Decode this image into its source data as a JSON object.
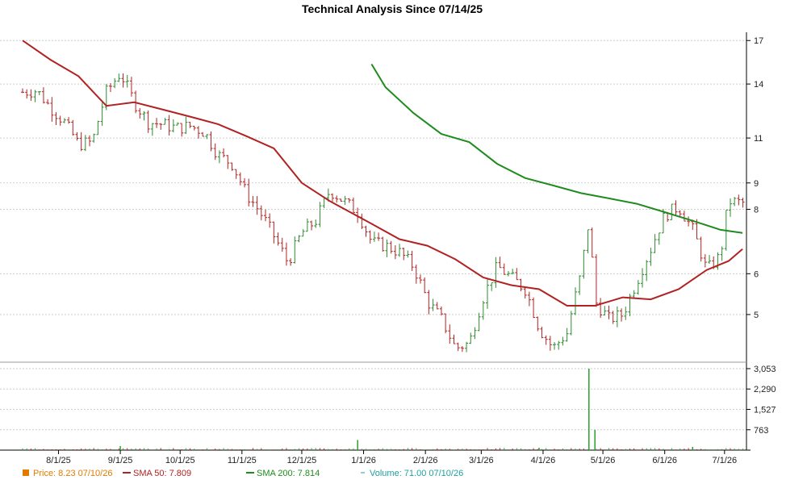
{
  "chart_data": {
    "type": "line",
    "title": "Technical Analysis Since 07/14/25",
    "price_axis": {
      "ticks": [
        "17",
        "14",
        "11",
        "9",
        "8",
        "6",
        "5"
      ],
      "tick_values": [
        17,
        14,
        11,
        9,
        8,
        6,
        5
      ],
      "scale": "log",
      "range": [
        4.1,
        17.2
      ]
    },
    "volume_axis": {
      "ticks": [
        "3,053",
        "2,290",
        "1,527",
        "763"
      ],
      "tick_values": [
        3053,
        2290,
        1527,
        763
      ],
      "range": [
        0,
        3053
      ]
    },
    "x_axis": {
      "ticks": [
        "8/1/25",
        "9/1/25",
        "10/1/25",
        "11/1/25",
        "12/1/25",
        "1/1/26",
        "2/1/26",
        "3/1/26",
        "4/1/26",
        "5/1/26",
        "6/1/26",
        "7/1/26"
      ],
      "tick_dates": [
        "2025-08-01",
        "2025-09-01",
        "2025-10-01",
        "2025-11-01",
        "2025-12-01",
        "2026-01-01",
        "2026-02-01",
        "2026-03-01",
        "2026-04-01",
        "2026-05-01",
        "2026-06-01",
        "2026-07-01"
      ]
    },
    "grid": true,
    "colors": {
      "up": "#2e8b2e",
      "down": "#b22222",
      "sma50": "#b22222",
      "sma200": "#1e8c1e",
      "volume": "#2aa02a",
      "price_legend": "#e07b00",
      "volume_legend": "#20a0a0"
    },
    "price_closes": [
      {
        "date": "2025-07-14",
        "close": 13.5
      },
      {
        "date": "2025-07-21",
        "close": 13.6
      },
      {
        "date": "2025-07-28",
        "close": 12.6
      },
      {
        "date": "2025-08-04",
        "close": 11.8
      },
      {
        "date": "2025-08-11",
        "close": 10.7
      },
      {
        "date": "2025-08-18",
        "close": 10.8
      },
      {
        "date": "2025-08-25",
        "close": 13.5
      },
      {
        "date": "2025-09-01",
        "close": 14.7
      },
      {
        "date": "2025-09-08",
        "close": 12.9
      },
      {
        "date": "2025-09-15",
        "close": 11.8
      },
      {
        "date": "2025-09-22",
        "close": 11.7
      },
      {
        "date": "2025-09-29",
        "close": 11.5
      },
      {
        "date": "2025-10-06",
        "close": 11.6
      },
      {
        "date": "2025-10-13",
        "close": 11.3
      },
      {
        "date": "2025-10-20",
        "close": 10.2
      },
      {
        "date": "2025-10-27",
        "close": 9.8
      },
      {
        "date": "2025-11-03",
        "close": 8.6
      },
      {
        "date": "2025-11-10",
        "close": 7.9
      },
      {
        "date": "2025-11-17",
        "close": 7.1
      },
      {
        "date": "2025-11-24",
        "close": 6.3
      },
      {
        "date": "2025-12-01",
        "close": 7.2
      },
      {
        "date": "2025-12-08",
        "close": 7.6
      },
      {
        "date": "2025-12-15",
        "close": 8.7
      },
      {
        "date": "2025-12-22",
        "close": 8.3
      },
      {
        "date": "2025-12-29",
        "close": 7.9
      },
      {
        "date": "2026-01-05",
        "close": 6.9
      },
      {
        "date": "2026-01-12",
        "close": 6.8
      },
      {
        "date": "2026-01-19",
        "close": 6.6
      },
      {
        "date": "2026-01-26",
        "close": 6.2
      },
      {
        "date": "2026-02-02",
        "close": 5.3
      },
      {
        "date": "2026-02-09",
        "close": 4.9
      },
      {
        "date": "2026-02-16",
        "close": 4.3
      },
      {
        "date": "2026-02-23",
        "close": 4.4
      },
      {
        "date": "2026-03-02",
        "close": 5.4
      },
      {
        "date": "2026-03-09",
        "close": 6.2
      },
      {
        "date": "2026-03-16",
        "close": 5.9
      },
      {
        "date": "2026-03-23",
        "close": 5.6
      },
      {
        "date": "2026-03-30",
        "close": 4.7
      },
      {
        "date": "2026-04-06",
        "close": 4.3
      },
      {
        "date": "2026-04-13",
        "close": 4.6
      },
      {
        "date": "2026-04-20",
        "close": 6.0
      },
      {
        "date": "2026-04-24",
        "close": 7.6
      },
      {
        "date": "2026-04-27",
        "close": 5.3
      },
      {
        "date": "2026-05-04",
        "close": 4.9
      },
      {
        "date": "2026-05-11",
        "close": 5.0
      },
      {
        "date": "2026-05-18",
        "close": 5.8
      },
      {
        "date": "2026-05-25",
        "close": 6.7
      },
      {
        "date": "2026-06-01",
        "close": 7.8
      },
      {
        "date": "2026-06-08",
        "close": 8.1
      },
      {
        "date": "2026-06-15",
        "close": 7.3
      },
      {
        "date": "2026-06-22",
        "close": 6.1
      },
      {
        "date": "2026-06-29",
        "close": 6.5
      },
      {
        "date": "2026-07-03",
        "close": 8.3
      },
      {
        "date": "2026-07-10",
        "close": 8.23
      }
    ],
    "sma50_points": [
      {
        "date": "2025-07-14",
        "value": 17.0
      },
      {
        "date": "2025-07-28",
        "value": 15.6
      },
      {
        "date": "2025-08-11",
        "value": 14.5
      },
      {
        "date": "2025-08-25",
        "value": 12.7
      },
      {
        "date": "2025-09-08",
        "value": 12.9
      },
      {
        "date": "2025-09-22",
        "value": 12.5
      },
      {
        "date": "2025-10-06",
        "value": 12.1
      },
      {
        "date": "2025-10-20",
        "value": 11.7
      },
      {
        "date": "2025-11-03",
        "value": 11.1
      },
      {
        "date": "2025-11-17",
        "value": 10.5
      },
      {
        "date": "2025-12-01",
        "value": 9.0
      },
      {
        "date": "2025-12-15",
        "value": 8.3
      },
      {
        "date": "2026-01-05",
        "value": 7.5
      },
      {
        "date": "2026-01-19",
        "value": 7.0
      },
      {
        "date": "2026-02-02",
        "value": 6.8
      },
      {
        "date": "2026-02-16",
        "value": 6.4
      },
      {
        "date": "2026-03-02",
        "value": 5.9
      },
      {
        "date": "2026-03-16",
        "value": 5.7
      },
      {
        "date": "2026-03-30",
        "value": 5.6
      },
      {
        "date": "2026-04-13",
        "value": 5.2
      },
      {
        "date": "2026-04-27",
        "value": 5.2
      },
      {
        "date": "2026-05-11",
        "value": 5.4
      },
      {
        "date": "2026-05-25",
        "value": 5.35
      },
      {
        "date": "2026-06-08",
        "value": 5.6
      },
      {
        "date": "2026-06-22",
        "value": 6.1
      },
      {
        "date": "2026-07-03",
        "value": 6.35
      },
      {
        "date": "2026-07-10",
        "value": 6.7
      }
    ],
    "sma200_points": [
      {
        "date": "2026-01-05",
        "value": 15.3
      },
      {
        "date": "2026-01-12",
        "value": 13.8
      },
      {
        "date": "2026-01-26",
        "value": 12.3
      },
      {
        "date": "2026-02-09",
        "value": 11.2
      },
      {
        "date": "2026-02-23",
        "value": 10.8
      },
      {
        "date": "2026-03-09",
        "value": 9.8
      },
      {
        "date": "2026-03-23",
        "value": 9.2
      },
      {
        "date": "2026-04-06",
        "value": 8.9
      },
      {
        "date": "2026-04-20",
        "value": 8.6
      },
      {
        "date": "2026-05-04",
        "value": 8.4
      },
      {
        "date": "2026-05-18",
        "value": 8.2
      },
      {
        "date": "2026-06-01",
        "value": 7.9
      },
      {
        "date": "2026-06-15",
        "value": 7.6
      },
      {
        "date": "2026-06-29",
        "value": 7.3
      },
      {
        "date": "2026-07-10",
        "value": 7.2
      }
    ],
    "volume_spikes": [
      {
        "date": "2025-09-01",
        "value": 150
      },
      {
        "date": "2025-12-29",
        "value": 380
      },
      {
        "date": "2026-03-30",
        "value": 90
      },
      {
        "date": "2026-04-24",
        "value": 3053
      },
      {
        "date": "2026-04-27",
        "value": 760
      },
      {
        "date": "2026-06-15",
        "value": 120
      }
    ],
    "legend": [
      {
        "key": "price",
        "text": "Price: 8.23  07/10/26",
        "symbol": "square"
      },
      {
        "key": "sma50",
        "text": "SMA 50: 7.809",
        "symbol": "line"
      },
      {
        "key": "sma200",
        "text": "SMA 200: 7.814",
        "symbol": "line"
      },
      {
        "key": "volume",
        "text": "Volume: 71.00  07/10/26",
        "symbol": "dash"
      }
    ]
  }
}
